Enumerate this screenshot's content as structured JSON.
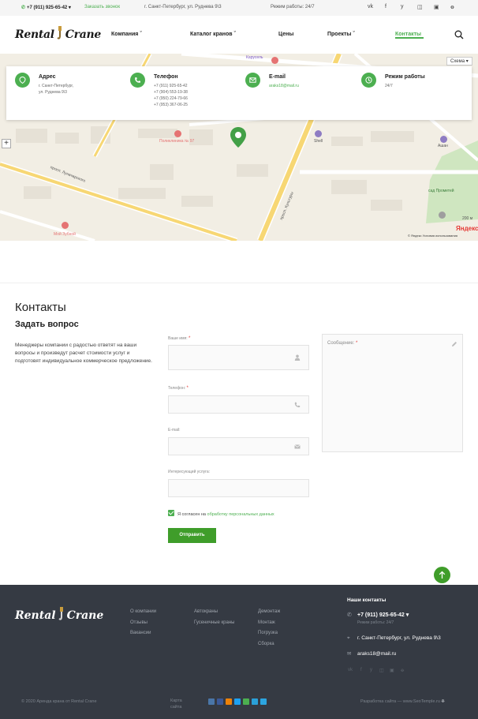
{
  "topbar": {
    "phone": "+7 (911) 925-65-42",
    "callback": "Заказать звонок",
    "address": "г. Санкт-Петербург, ул. Руднева 9\\3",
    "hours": "Режим работы: 24/7",
    "social": [
      "vk-icon",
      "facebook-icon",
      "twitter-icon",
      "instagram-icon",
      "youtube-icon",
      "odnoklassniki-icon"
    ]
  },
  "header": {
    "logo_left": "Rental",
    "logo_right": "Crane",
    "nav": [
      {
        "label": "Компания",
        "dropdown": true
      },
      {
        "label": "Каталог кранов",
        "dropdown": true
      },
      {
        "label": "Цены",
        "dropdown": false
      },
      {
        "label": "Проекты",
        "dropdown": true
      },
      {
        "label": "Контакты",
        "dropdown": false,
        "active": true
      }
    ]
  },
  "map": {
    "scheme_button": "Схема",
    "scale": "200 м",
    "brand": "Яндекс",
    "legal": "© Яндекс  Условия использования",
    "labels": [
      "Карусель",
      "Поликлиника № 97",
      "Shell",
      "просп. Луначарского",
      "Учебный пер.",
      "Мой Зубной",
      "улица Руднева",
      "просп. Культуры",
      "Ашан",
      "сад Прометей",
      "Автомойка Шевельница"
    ]
  },
  "info": {
    "address": {
      "title": "Адрес",
      "lines": [
        "г. Санкт-Петербург,",
        "ул. Руднева 9\\3"
      ]
    },
    "phone": {
      "title": "Телефон",
      "lines": [
        "+7 (911) 925-65-42",
        "+7 (904) 553-19-38",
        "+7 (950) 224-79-66",
        "+7 (953) 367-06-25"
      ]
    },
    "email": {
      "title": "E-mail",
      "lines": [
        "araks18@mail.ru"
      ]
    },
    "hours": {
      "title": "Режим работы",
      "lines": [
        "24/7"
      ]
    }
  },
  "contacts": {
    "title": "Контакты",
    "subtitle": "Задать вопрос",
    "intro": "Менеджеры компании с радостью ответят на ваши вопросы и произведут расчет стоимости услуг и подготовят индивидуальное коммерческое предложение."
  },
  "form": {
    "name_label": "Ваше имя:",
    "phone_label": "Телефон:",
    "email_label": "E-mail:",
    "service_label": "Интересующий услуга:",
    "message_label": "Сообщение:",
    "required_mark": "*",
    "agree_text": "Я согласен на ",
    "agree_link": "обработку персональных данных",
    "submit": "Отправить"
  },
  "footer": {
    "logo_left": "Rental",
    "logo_right": "Crane",
    "col1": [
      "О компании",
      "Отзывы",
      "Вакансии"
    ],
    "col2": [
      "Автокраны",
      "Гусеничные краны"
    ],
    "col3": [
      "Демонтаж",
      "Монтаж",
      "Погрузка",
      "Сборка"
    ],
    "contacts_title": "Наши контакты",
    "phone": "+7 (911) 925-65-42",
    "hours": "Режим работы: 24/7",
    "address": "г. Санкт-Петербург, ул. Руднева 9\\3",
    "email": "araks18@mail.ru",
    "copyright": "© 2020 Аренда крана от Rental Crane",
    "sitemap": "Карта сайта",
    "developer": "Разработка сайта — www.SeoTemple.ru",
    "share_colors": [
      "#4a76a8",
      "#3b5998",
      "#ee8208",
      "#1da1f2",
      "#4caf50",
      "#2aa0d8",
      "#2ca5e0"
    ]
  },
  "colors": {
    "accent": "#4caf50",
    "button": "#3f9d2a",
    "footer_bg": "#353a43"
  }
}
